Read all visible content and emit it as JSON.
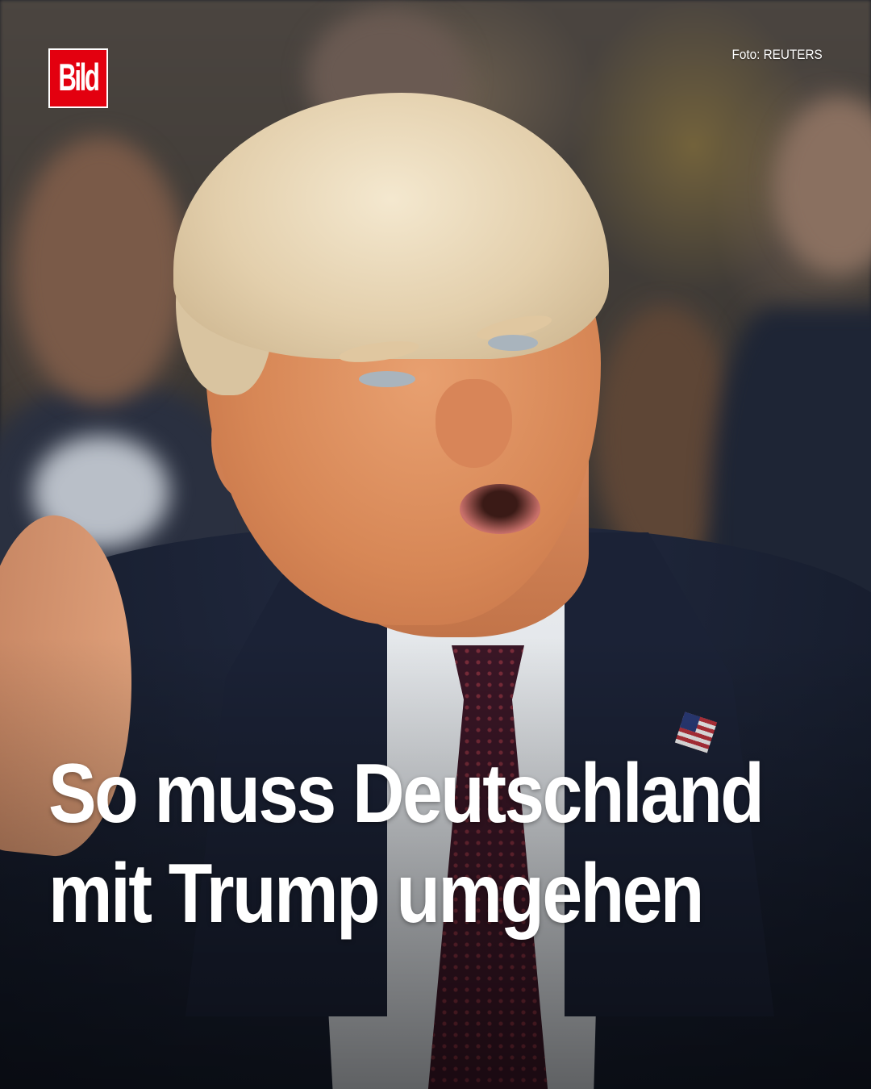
{
  "brand": {
    "logo_text": "Bild",
    "color": "#e3000f"
  },
  "photo": {
    "credit": "Foto: REUTERS"
  },
  "headline": {
    "lines": [
      "So muss Deutschland",
      "mit Trump umgehen"
    ]
  }
}
